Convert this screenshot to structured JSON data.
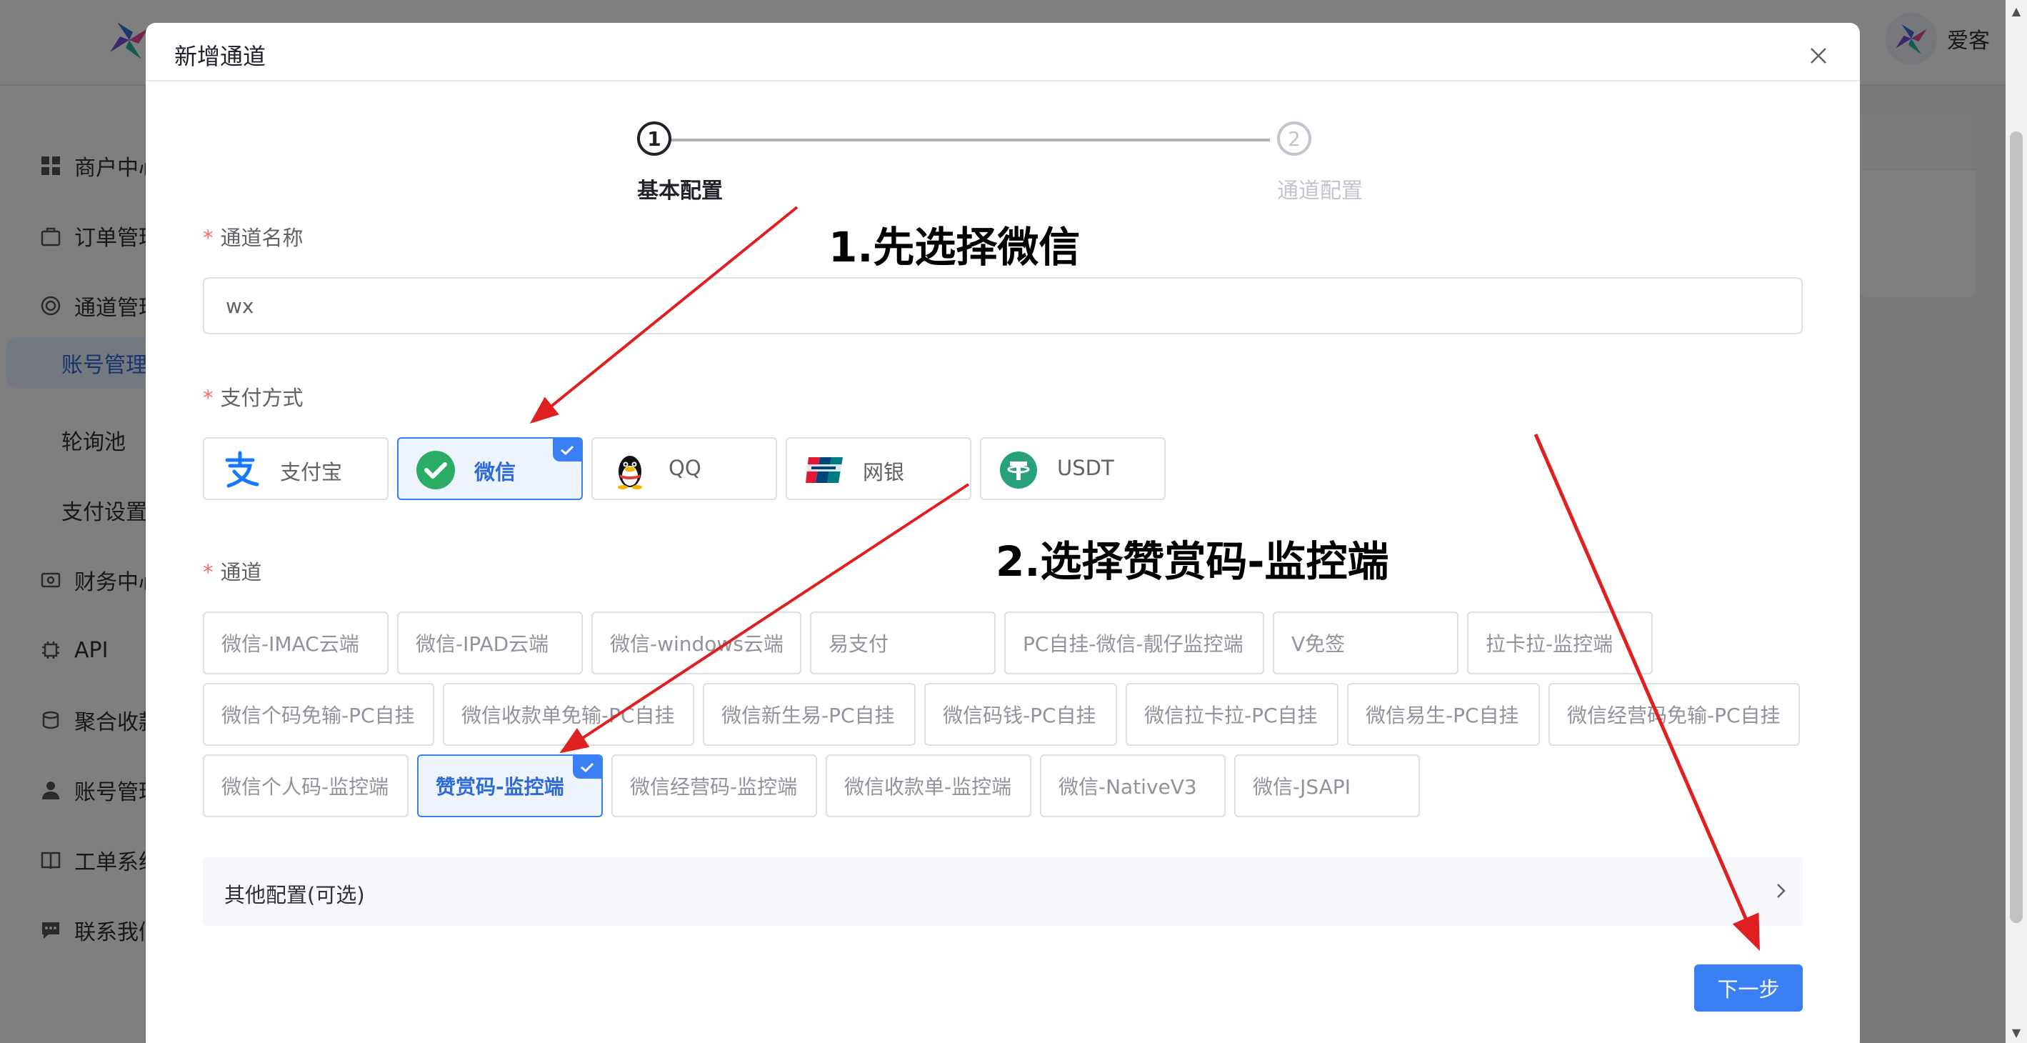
{
  "app": {
    "user_name": "爱客",
    "menu": [
      {
        "label": "商户中心",
        "icon": "grid-icon"
      },
      {
        "label": "订单管理",
        "icon": "bag-icon"
      },
      {
        "label": "通道管理",
        "icon": "circle-icon"
      },
      {
        "label": "账号管理",
        "icon": "none",
        "active": true
      },
      {
        "label": "轮询池",
        "icon": "none"
      },
      {
        "label": "支付设置",
        "icon": "none"
      },
      {
        "label": "财务中心",
        "icon": "wallet-icon"
      },
      {
        "label": "API",
        "icon": "chip-icon"
      },
      {
        "label": "聚合收款",
        "icon": "coins-icon"
      },
      {
        "label": "账号管理",
        "icon": "person-icon"
      },
      {
        "label": "工单系统",
        "icon": "book-icon"
      },
      {
        "label": "联系我们",
        "icon": "chat-icon"
      }
    ]
  },
  "dialog": {
    "title": "新增通道",
    "steps": [
      {
        "number": "1",
        "label": "基本配置",
        "status": "active"
      },
      {
        "number": "2",
        "label": "通道配置",
        "status": "pending"
      }
    ],
    "channel_name": {
      "label": "通道名称",
      "value": "wx"
    },
    "payment_method": {
      "label": "支付方式",
      "options": [
        {
          "label": "支付宝",
          "icon": "alipay-icon",
          "selected": false
        },
        {
          "label": "微信",
          "icon": "wechat-icon",
          "selected": true
        },
        {
          "label": "QQ",
          "icon": "qq-penguin-icon",
          "selected": false
        },
        {
          "label": "网银",
          "icon": "unionpay-icon",
          "selected": false
        },
        {
          "label": "USDT",
          "icon": "tether-icon",
          "selected": false
        }
      ]
    },
    "channel": {
      "label": "通道",
      "options": [
        "微信-IMAC云端",
        "微信-IPAD云端",
        "微信-windows云端",
        "易支付",
        "PC自挂-微信-靓仔监控端",
        "V免签",
        "拉卡拉-监控端",
        "微信个码免输-PC自挂",
        "微信收款单免输-PC自挂",
        "微信新生易-PC自挂",
        "微信码钱-PC自挂",
        "微信拉卡拉-PC自挂",
        "微信易生-PC自挂",
        "微信经营码免输-PC自挂",
        "微信个人码-监控端",
        "赞赏码-监控端",
        "微信经营码-监控端",
        "微信收款单-监控端",
        "微信-NativeV3",
        "微信-JSAPI"
      ],
      "selected": "赞赏码-监控端"
    },
    "other_config": {
      "label": "其他配置(可选)"
    },
    "next_button": "下一步"
  },
  "annotations": {
    "step1": "1.先选择微信",
    "step2": "2.选择赞赏码-监控端",
    "arrow_color": "#e02020"
  },
  "colors": {
    "primary": "#3b7ff5",
    "required": "#f56c6c",
    "wechat": "#2aae67"
  }
}
